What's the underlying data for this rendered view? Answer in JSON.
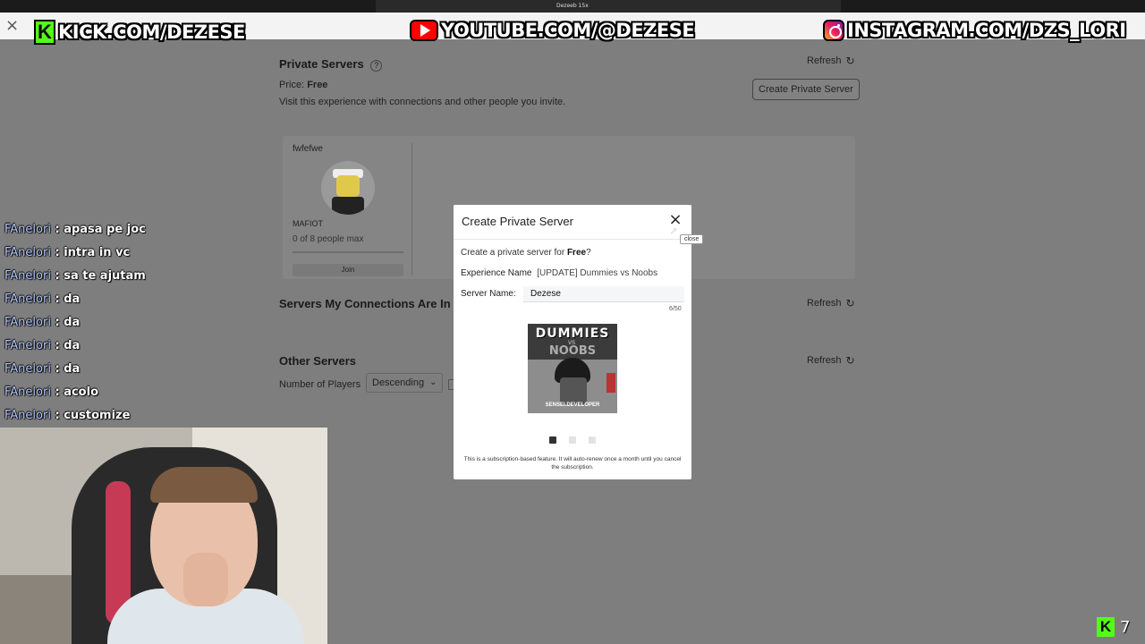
{
  "overlay": {
    "top_small_text": "Dezeeb 15x",
    "kick": "KICK.COM/DEZESE",
    "youtube": "YOUTUBE.COM/@DEZESE",
    "instagram": "INSTAGRAM.COM/DZS_LORI",
    "close_glyph": "×",
    "viewer_count": "7",
    "kick_letter": "K"
  },
  "page": {
    "private_servers_title": "Private Servers",
    "help_glyph": "?",
    "refresh_label": "Refresh",
    "refresh_glyph": "↻",
    "price_label": "Price:",
    "price_value": "Free",
    "description": "Visit this experience with connections and other people you invite.",
    "create_button": "Create Private Server",
    "server_card": {
      "name": "fwfefwe",
      "owner": "MAFIOT",
      "capacity": "0 of 8 people max",
      "join_label": "Join"
    },
    "connections_title": "Servers My Connections Are In",
    "other_servers_title": "Other Servers",
    "number_of_players_label": "Number of Players",
    "sort_value": "Descending",
    "sort_chevron": "⌄"
  },
  "chat": {
    "messages": [
      {
        "user": "FAnelori",
        "text": "apasa pe joc"
      },
      {
        "user": "FAnelori",
        "text": "intra in vc"
      },
      {
        "user": "FAnelori",
        "text": "sa te ajutam"
      },
      {
        "user": "FAnelori",
        "text": "da"
      },
      {
        "user": "FAnelori",
        "text": "da"
      },
      {
        "user": "FAnelori",
        "text": "da"
      },
      {
        "user": "FAnelori",
        "text": "da"
      },
      {
        "user": "FAnelori",
        "text": "acolo"
      },
      {
        "user": "FAnelori",
        "text": "customize"
      }
    ]
  },
  "modal": {
    "title": "Create Private Server",
    "close_glyph": "×",
    "close_tooltip": "close",
    "create_for_prefix": "Create a private server for",
    "create_for_price": "Free",
    "create_for_suffix": "?",
    "experience_label": "Experience Name",
    "experience_value": "[UPDATE] Dummies vs Noobs",
    "server_name_label": "Server Name:",
    "server_name_value": "Dezese",
    "char_counter": "6/50",
    "thumbnail": {
      "title": "DUMMIES",
      "vs": "VS",
      "subtitle": "NOOBS",
      "credit": "SENSEI.DEVELOPER"
    },
    "carousel": {
      "count": 3,
      "active": 0
    },
    "note": "This is a subscription-based feature. It will auto-renew once a month until you cancel the subscription."
  }
}
